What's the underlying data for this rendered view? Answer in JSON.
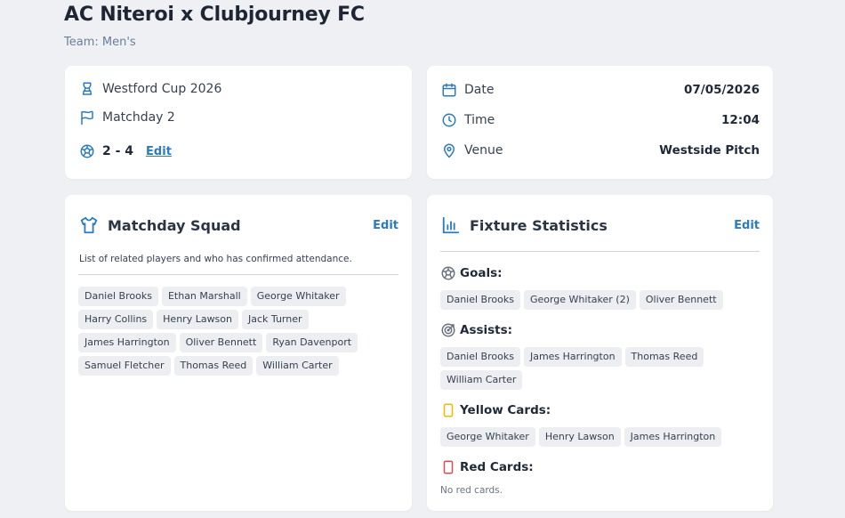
{
  "page": {
    "title": "AC Niteroi x Clubjourney FC",
    "team": "Team: Men's"
  },
  "match": {
    "competition": "Westford Cup 2026",
    "matchday": "Matchday 2",
    "score": "2 - 4",
    "edit_label": "Edit"
  },
  "details": {
    "date_label": "Date",
    "date_value": "07/05/2026",
    "time_label": "Time",
    "time_value": "12:04",
    "venue_label": "Venue",
    "venue_value": "Westside Pitch"
  },
  "squad": {
    "title": "Matchday Squad",
    "edit_label": "Edit",
    "description": "List of related players and who has confirmed attendance.",
    "players": [
      "Daniel Brooks",
      "Ethan Marshall",
      "George Whitaker",
      "Harry Collins",
      "Henry Lawson",
      "Jack Turner",
      "James Harrington",
      "Oliver Bennett",
      "Ryan Davenport",
      "Samuel Fletcher",
      "Thomas Reed",
      "William Carter"
    ]
  },
  "stats": {
    "title": "Fixture Statistics",
    "edit_label": "Edit",
    "goals_label": "Goals:",
    "goals": [
      "Daniel Brooks",
      "George Whitaker (2)",
      "Oliver Bennett"
    ],
    "assists_label": "Assists:",
    "assists": [
      "Daniel Brooks",
      "James Harrington",
      "Thomas Reed",
      "William Carter"
    ],
    "yellow_label": "Yellow Cards:",
    "yellow": [
      "George Whitaker",
      "Henry Lawson",
      "James Harrington"
    ],
    "red_label": "Red Cards:",
    "red_empty": "No red cards."
  },
  "colors": {
    "accent": "#2b7bbd",
    "yellow_card": "#f5b800",
    "red_card": "#e5484d"
  }
}
